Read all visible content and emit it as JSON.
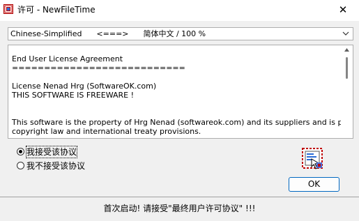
{
  "window": {
    "title": "许可 - NewFileTime",
    "close_glyph": "✕"
  },
  "language_select": {
    "value": "Chinese-Simplified      <===>      简体中文 / 100 %"
  },
  "license": {
    "lines": [
      "End User License Agreement",
      "===========================",
      "",
      "License Nenad Hrg (SoftwareOK.com)",
      "THIS SOFTWARE IS FREEWARE !",
      "",
      "",
      "This software is the property of Hrg Nenad (softwareok.com) and its suppliers and is protected by",
      "copyright law and international treaty provisions."
    ]
  },
  "options": {
    "accept": "我接受该协议",
    "decline": "我不接受该协议",
    "selected": "accept"
  },
  "buttons": {
    "ok": "OK"
  },
  "status": {
    "text": "首次启动! 请接受\"最终用户许可协议\" !!!"
  },
  "colors": {
    "accent": "#0067c0",
    "app_icon_red": "#c00000"
  },
  "icons": {
    "close": "close-icon",
    "dropdown": "chevron-down-icon",
    "cert": "certificate-icon"
  }
}
